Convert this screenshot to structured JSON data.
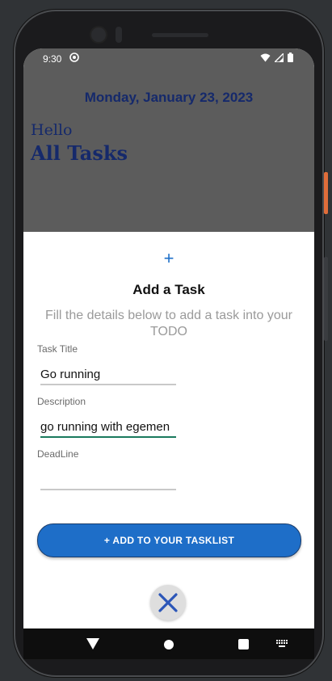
{
  "status": {
    "time": "9:30"
  },
  "header": {
    "date": "Monday, January 23, 2023",
    "greeting": "Hello",
    "title": "All Tasks"
  },
  "sheet": {
    "plus_symbol": "+",
    "title": "Add a Task",
    "subtitle": "Fill the details below to add a task into your TODO",
    "fields": [
      {
        "label": "Task Title",
        "value": "Go running"
      },
      {
        "label": "Description",
        "value": "go running with egemen"
      },
      {
        "label": "DeadLine",
        "value": ""
      }
    ],
    "add_button_label": "+ ADD TO YOUR TASKLIST"
  },
  "colors": {
    "accent": "#1e6ec8",
    "header_text": "#15296b",
    "focus_underline": "#1a7a5e",
    "scrim": "#5c5c5c"
  },
  "icons": {
    "status_left": "do-not-disturb-icon",
    "wifi": "wifi-icon",
    "signal": "signal-icon",
    "battery": "battery-icon",
    "close": "close-icon",
    "nav_back": "nav-back-icon",
    "nav_home": "nav-home-icon",
    "nav_recent": "nav-recents-icon",
    "nav_keyboard": "keyboard-icon"
  }
}
